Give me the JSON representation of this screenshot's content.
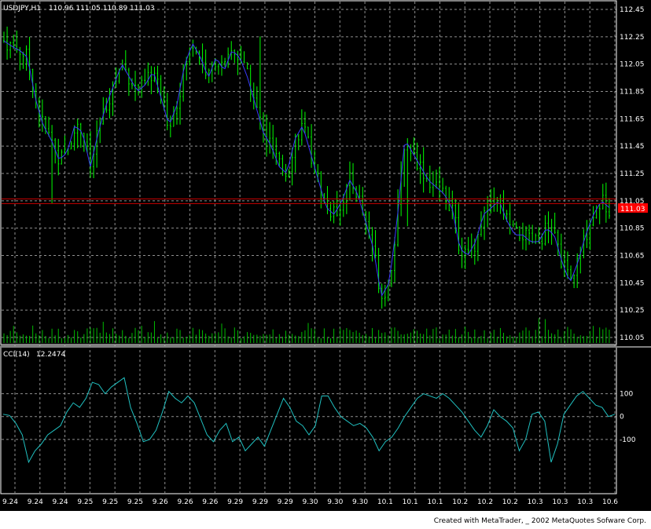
{
  "header": {
    "symbol": "USDJPY,H1",
    "ohlc": "110.96 111.05 110.89 111.03"
  },
  "indicator": {
    "name": "CCI(14)",
    "value": "12.2474",
    "levels": [
      "100",
      "0",
      "-100"
    ]
  },
  "current_price_label": "111.03",
  "footer": "Created with MetaTrader, _ 2002 MetaQuotes Sofware Corp.",
  "colors": {
    "background": "#000000",
    "candle": "#00ff00",
    "ma_line": "#3a3aff",
    "ma_line_alt": "#ff0000",
    "grid": "#8f8f8f",
    "volume": "#00bb00",
    "cci": "#20c0c0",
    "price_line": "#cc0000",
    "price_tag_bg": "#ff0000",
    "axis_text": "#ffffff"
  },
  "chart_data": [
    {
      "type": "candlestick",
      "title": "USDJPY,H1",
      "y_ticks": [
        "112.45",
        "112.25",
        "112.05",
        "111.85",
        "111.65",
        "111.45",
        "111.25",
        "111.05",
        "110.85",
        "110.65",
        "110.45",
        "110.25",
        "110.05"
      ],
      "ylim": [
        110.0,
        112.48
      ],
      "x_ticks": [
        "9.24",
        "9.24",
        "9.24",
        "9.25",
        "9.25",
        "9.25",
        "9.26",
        "9.26",
        "9.26",
        "9.29",
        "9.29",
        "9.29",
        "9.30",
        "9.30",
        "9.30",
        "10.1",
        "10.1",
        "10.1",
        "10.2",
        "10.2",
        "10.2",
        "10.3",
        "10.3",
        "10.3",
        "10.6"
      ],
      "grid": true,
      "close_approx": [
        112.22,
        112.18,
        112.15,
        112.1,
        111.8,
        111.6,
        111.5,
        111.35,
        111.4,
        111.6,
        111.55,
        111.3,
        111.55,
        111.75,
        111.9,
        112.05,
        111.95,
        111.85,
        111.9,
        112.0,
        111.8,
        111.6,
        111.75,
        112.05,
        112.2,
        112.1,
        111.95,
        112.1,
        112.0,
        112.15,
        112.1,
        111.95,
        111.75,
        111.55,
        111.45,
        111.3,
        111.25,
        111.5,
        111.6,
        111.4,
        111.2,
        111.0,
        110.95,
        111.05,
        111.2,
        111.1,
        110.9,
        110.7,
        110.35,
        110.45,
        110.9,
        111.5,
        111.4,
        111.3,
        111.2,
        111.15,
        111.1,
        111.0,
        110.7,
        110.65,
        110.75,
        110.95,
        111.0,
        111.05,
        110.9,
        110.8,
        110.8,
        110.75,
        110.75,
        110.85,
        110.8,
        110.6,
        110.45,
        110.6,
        110.8,
        110.95,
        111.05,
        111.0
      ]
    },
    {
      "type": "bar",
      "title": "Volume",
      "note": "volume histogram at bottom of price panel"
    },
    {
      "type": "line",
      "title": "CCI(14)",
      "y_levels": [
        100,
        0,
        -100
      ],
      "ylim": [
        -300,
        250
      ],
      "values": [
        10,
        5,
        -30,
        -80,
        -200,
        -150,
        -120,
        -80,
        -60,
        -40,
        20,
        60,
        40,
        80,
        150,
        140,
        100,
        130,
        150,
        170,
        40,
        -30,
        -110,
        -100,
        -60,
        20,
        110,
        80,
        60,
        90,
        60,
        -10,
        -80,
        -110,
        -60,
        -30,
        -110,
        -90,
        -150,
        -120,
        -90,
        -130,
        -60,
        10,
        80,
        40,
        -20,
        -40,
        -80,
        -40,
        90,
        90,
        40,
        0,
        -20,
        -40,
        -30,
        -50,
        -90,
        -150,
        -110,
        -90,
        -50,
        0,
        40,
        80,
        100,
        90,
        80,
        100,
        80,
        50,
        20,
        -20,
        -60,
        -90,
        -40,
        30,
        0,
        -20,
        -50,
        -150,
        -100,
        10,
        20,
        -20,
        -200,
        -120,
        10,
        50,
        90,
        110,
        80,
        50,
        40,
        0,
        10
      ]
    }
  ]
}
